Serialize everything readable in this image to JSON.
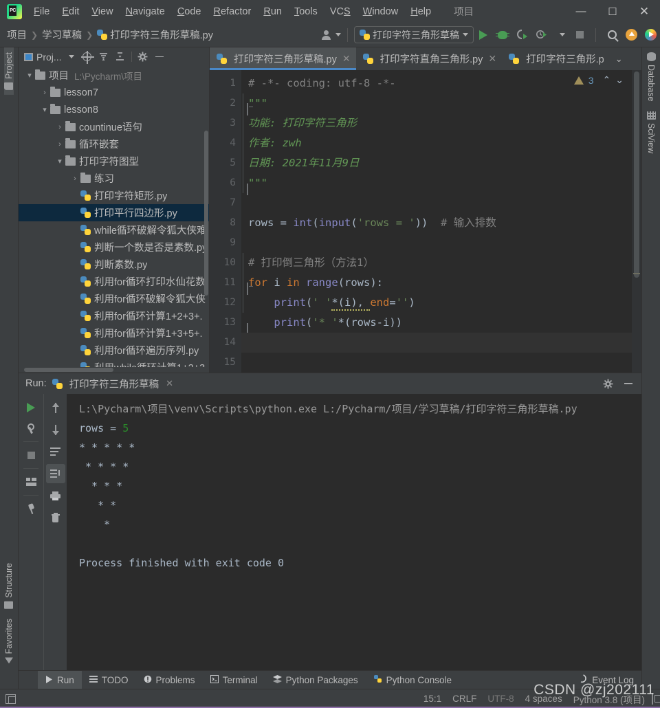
{
  "window": {
    "title": "项目",
    "logo_icon": "pycharm-logo-icon",
    "minimize": "—",
    "maximize": "☐",
    "close": "✕"
  },
  "menubar": {
    "items": [
      {
        "label": "File",
        "mnemonic": "F"
      },
      {
        "label": "Edit",
        "mnemonic": "E"
      },
      {
        "label": "View",
        "mnemonic": "V"
      },
      {
        "label": "Navigate",
        "mnemonic": "N"
      },
      {
        "label": "Code",
        "mnemonic": "C"
      },
      {
        "label": "Refactor",
        "mnemonic": "R"
      },
      {
        "label": "Run",
        "mnemonic": "R"
      },
      {
        "label": "Tools",
        "mnemonic": "T"
      },
      {
        "label": "VCS",
        "mnemonic": "S"
      },
      {
        "label": "Window",
        "mnemonic": "W"
      },
      {
        "label": "Help",
        "mnemonic": "H"
      }
    ]
  },
  "toolbar": {
    "breadcrumb": [
      "项目",
      "学习草稿",
      "打印字符三角形草稿.py"
    ],
    "breadcrumb_file_icon": "python-file-icon",
    "vcs_user_icon": "user-avatar-icon",
    "run_config": "打印字符三角形草稿",
    "run_config_icon": "python-file-icon",
    "buttons": [
      {
        "name": "run-button",
        "icon": "play-icon"
      },
      {
        "name": "debug-button",
        "icon": "bug-icon"
      },
      {
        "name": "run-with-coverage-button",
        "icon": "coverage-icon"
      },
      {
        "name": "profile-button",
        "icon": "profiler-icon"
      },
      {
        "name": "stop-button",
        "icon": "stop-icon"
      },
      {
        "name": "search-everywhere-button",
        "icon": "search-icon"
      },
      {
        "name": "update-project-button",
        "icon": "update-arrow-icon"
      },
      {
        "name": "datalore-button",
        "icon": "datalore-icon"
      }
    ]
  },
  "left_rail": {
    "top": [
      {
        "label": "Project",
        "icon": "folder-icon",
        "active": true
      }
    ],
    "bottom": [
      {
        "label": "Structure",
        "icon": "structure-icon"
      },
      {
        "label": "Favorites",
        "icon": "star-icon"
      }
    ]
  },
  "right_rail": {
    "items": [
      {
        "label": "Database",
        "icon": "database-icon"
      },
      {
        "label": "SciView",
        "icon": "grid-icon"
      }
    ]
  },
  "project_pane": {
    "title": "Proj...",
    "title_icon": "project-view-icon",
    "toolbar": [
      {
        "name": "select-opened-file-button",
        "icon": "target-icon"
      },
      {
        "name": "expand-all-button",
        "icon": "expand-all-icon"
      },
      {
        "name": "collapse-all-button",
        "icon": "collapse-all-icon"
      },
      {
        "name": "settings-button",
        "icon": "gear-icon"
      },
      {
        "name": "hide-button",
        "icon": "minimize-icon"
      }
    ],
    "tree": [
      {
        "indent": 0,
        "arrow": "▾",
        "type": "folder",
        "label": "项目",
        "path": "L:\\Pycharm\\项目",
        "selected": false
      },
      {
        "indent": 1,
        "arrow": "›",
        "type": "folder",
        "label": "lesson7",
        "path": "",
        "selected": false
      },
      {
        "indent": 1,
        "arrow": "▾",
        "type": "folder",
        "label": "lesson8",
        "path": "",
        "selected": false
      },
      {
        "indent": 2,
        "arrow": "›",
        "type": "folder",
        "label": "countinue语句",
        "path": "",
        "selected": false
      },
      {
        "indent": 2,
        "arrow": "›",
        "type": "folder",
        "label": "循环嵌套",
        "path": "",
        "selected": false
      },
      {
        "indent": 2,
        "arrow": "▾",
        "type": "folder",
        "label": "打印字符图型",
        "path": "",
        "selected": false
      },
      {
        "indent": 3,
        "arrow": "›",
        "type": "folder",
        "label": "练习",
        "path": "",
        "selected": false
      },
      {
        "indent": 3,
        "arrow": "",
        "type": "python",
        "label": "打印字符矩形.py",
        "path": "",
        "selected": false
      },
      {
        "indent": 3,
        "arrow": "",
        "type": "python",
        "label": "打印平行四边形.py",
        "path": "",
        "selected": true
      },
      {
        "indent": 3,
        "arrow": "",
        "type": "python",
        "label": "while循环破解令狐大侠难",
        "path": "",
        "selected": false
      },
      {
        "indent": 3,
        "arrow": "",
        "type": "python",
        "label": "判断一个数是否是素数.py",
        "path": "",
        "selected": false
      },
      {
        "indent": 3,
        "arrow": "",
        "type": "python",
        "label": "判断素数.py",
        "path": "",
        "selected": false
      },
      {
        "indent": 3,
        "arrow": "",
        "type": "python",
        "label": "利用for循环打印水仙花数.",
        "path": "",
        "selected": false
      },
      {
        "indent": 3,
        "arrow": "",
        "type": "python",
        "label": "利用for循环破解令狐大侠",
        "path": "",
        "selected": false
      },
      {
        "indent": 3,
        "arrow": "",
        "type": "python",
        "label": "利用for循环计算1+2+3+.",
        "path": "",
        "selected": false
      },
      {
        "indent": 3,
        "arrow": "",
        "type": "python",
        "label": "利用for循环计算1+3+5+.",
        "path": "",
        "selected": false
      },
      {
        "indent": 3,
        "arrow": "",
        "type": "python",
        "label": "利用for循环遍历序列.py",
        "path": "",
        "selected": false
      },
      {
        "indent": 3,
        "arrow": "",
        "type": "python",
        "label": "利用while循环计算1+2+3",
        "path": "",
        "selected": false
      }
    ]
  },
  "editor": {
    "tabs": [
      {
        "label": "打印字符三角形草稿.py",
        "icon": "python-file-icon",
        "active": true,
        "close": "✕"
      },
      {
        "label": "打印字符直角三角形.py",
        "icon": "python-file-icon",
        "active": false,
        "close": "✕"
      },
      {
        "label": "打印字符三角形.p",
        "icon": "python-file-icon",
        "active": false,
        "close": ""
      }
    ],
    "tabs_overflow_icon": "chevron-down-icon",
    "inspection": {
      "count": "3",
      "icon": "warning-triangle-icon",
      "prev": "⌃",
      "next": "⌄"
    },
    "line_numbers": [
      "1",
      "2",
      "3",
      "4",
      "5",
      "6",
      "7",
      "8",
      "9",
      "10",
      "11",
      "12",
      "13",
      "14",
      "15"
    ],
    "lines": [
      {
        "n": 1,
        "tokens": [
          {
            "t": "# -*- coding: utf-8 -*-",
            "c": "c-comment"
          }
        ]
      },
      {
        "n": 2,
        "tokens": [
          {
            "t": "\"\"\"",
            "c": "c-doc"
          }
        ]
      },
      {
        "n": 3,
        "tokens": [
          {
            "t": "功能: 打印字符三角形",
            "c": "c-doc"
          }
        ]
      },
      {
        "n": 4,
        "tokens": [
          {
            "t": "作者: zwh",
            "c": "c-doc"
          }
        ]
      },
      {
        "n": 5,
        "tokens": [
          {
            "t": "日期: 2021年11月9日",
            "c": "c-doc"
          }
        ]
      },
      {
        "n": 6,
        "tokens": [
          {
            "t": "\"\"\"",
            "c": "c-doc"
          }
        ]
      },
      {
        "n": 7,
        "tokens": []
      },
      {
        "n": 8,
        "tokens": [
          {
            "t": "rows ",
            "c": "c-id"
          },
          {
            "t": "= ",
            "c": "c-id"
          },
          {
            "t": "int",
            "c": "c-bi"
          },
          {
            "t": "(",
            "c": "c-id"
          },
          {
            "t": "input",
            "c": "c-bi"
          },
          {
            "t": "(",
            "c": "c-id"
          },
          {
            "t": "'rows = '",
            "c": "c-str"
          },
          {
            "t": "))  ",
            "c": "c-id"
          },
          {
            "t": "# 输入排数",
            "c": "c-comment"
          }
        ]
      },
      {
        "n": 9,
        "tokens": []
      },
      {
        "n": 10,
        "tokens": [
          {
            "t": "# 打印倒三角形（方法1）",
            "c": "c-comment"
          }
        ]
      },
      {
        "n": 11,
        "tokens": [
          {
            "t": "for",
            "c": "c-kw"
          },
          {
            "t": " i ",
            "c": "c-id"
          },
          {
            "t": "in",
            "c": "c-kw"
          },
          {
            "t": " ",
            "c": "c-id"
          },
          {
            "t": "range",
            "c": "c-bi"
          },
          {
            "t": "(rows):",
            "c": "c-id"
          }
        ]
      },
      {
        "n": 12,
        "tokens": [
          {
            "t": "    ",
            "c": "c-id"
          },
          {
            "t": "print",
            "c": "c-bi"
          },
          {
            "t": "(",
            "c": "c-id"
          },
          {
            "t": "' '",
            "c": "c-str"
          },
          {
            "t": "*(i), ",
            "c": "c-id"
          },
          {
            "t": "end",
            "c": "c-kw"
          },
          {
            "t": "=",
            "c": "c-id"
          },
          {
            "t": "''",
            "c": "c-str"
          },
          {
            "t": ")",
            "c": "c-id"
          }
        ]
      },
      {
        "n": 13,
        "tokens": [
          {
            "t": "    ",
            "c": "c-id"
          },
          {
            "t": "print",
            "c": "c-bi"
          },
          {
            "t": "(",
            "c": "c-id"
          },
          {
            "t": "'* '",
            "c": "c-str"
          },
          {
            "t": "*(rows-i))",
            "c": "c-id"
          }
        ]
      },
      {
        "n": 14,
        "tokens": []
      },
      {
        "n": 15,
        "tokens": []
      }
    ]
  },
  "run_panel": {
    "label": "Run:",
    "tab_title": "打印字符三角形草稿",
    "tab_icon": "python-file-icon",
    "tab_close": "✕",
    "header_buttons": [
      {
        "name": "settings-button",
        "icon": "gear-icon"
      },
      {
        "name": "hide-button",
        "icon": "minimize-icon"
      }
    ],
    "left_toolbar": [
      {
        "name": "rerun-button",
        "icon": "play-icon"
      },
      {
        "name": "edit-configuration-button",
        "icon": "wrench-icon"
      },
      {
        "name": "stop-button",
        "icon": "stop-icon"
      },
      {
        "name": "layout-settings-button",
        "icon": "layout-icon"
      },
      {
        "name": "pin-tab-button",
        "icon": "pin-icon"
      }
    ],
    "right_toolbar": [
      {
        "name": "up-button",
        "icon": "arrow-up-icon"
      },
      {
        "name": "down-button",
        "icon": "arrow-down-icon"
      },
      {
        "name": "soft-wrap-button",
        "icon": "soft-wrap-icon"
      },
      {
        "name": "scroll-to-end-button",
        "icon": "scroll-to-end-icon",
        "selected": true
      },
      {
        "name": "print-button",
        "icon": "printer-icon"
      },
      {
        "name": "clear-all-button",
        "icon": "trash-icon"
      }
    ],
    "console": [
      {
        "text": "L:\\Pycharm\\项目\\venv\\Scripts\\python.exe L:/Pycharm/项目/学习草稿/打印字符三角形草稿.py",
        "cls": "path"
      },
      {
        "text": "rows = ",
        "cls": "",
        "suffix": "5",
        "suffix_cls": "num"
      },
      {
        "text": "* * * * *",
        "cls": ""
      },
      {
        "text": " * * * *",
        "cls": ""
      },
      {
        "text": "  * * *",
        "cls": ""
      },
      {
        "text": "   * *",
        "cls": ""
      },
      {
        "text": "    *",
        "cls": ""
      },
      {
        "text": "",
        "cls": ""
      },
      {
        "text": "Process finished with exit code 0",
        "cls": ""
      }
    ]
  },
  "bottom_strip": {
    "items": [
      {
        "label": "Run",
        "icon": "play-icon",
        "active": true
      },
      {
        "label": "TODO",
        "icon": "todo-list-icon",
        "active": false
      },
      {
        "label": "Problems",
        "icon": "problems-icon",
        "active": false
      },
      {
        "label": "Terminal",
        "icon": "terminal-icon",
        "active": false
      },
      {
        "label": "Python Packages",
        "icon": "packages-icon",
        "active": false
      },
      {
        "label": "Python Console",
        "icon": "python-console-icon",
        "active": false
      }
    ],
    "right": [
      {
        "label": "Event Log",
        "icon": "event-log-icon"
      }
    ]
  },
  "statusbar": {
    "window_icon": "show-tool-windows-icon",
    "caret": "15:1",
    "line_separator": "CRLF",
    "encoding": "UTF-8",
    "indent": "4 spaces",
    "interpreter": "Python 3.8 (项目)"
  },
  "watermark": "CSDN @zj202111",
  "colors": {
    "chrome": "#3c3f41",
    "editor_bg": "#2b2b2b",
    "gutter_bg": "#313335",
    "selection": "#0d293e",
    "tab_active": "#4e5254",
    "accent_blue": "#4a88c7",
    "keyword": "#cc7832",
    "string": "#6a8759",
    "comment": "#808080",
    "docstring": "#629755",
    "number": "#6897bb",
    "builtin": "#8888c6"
  }
}
